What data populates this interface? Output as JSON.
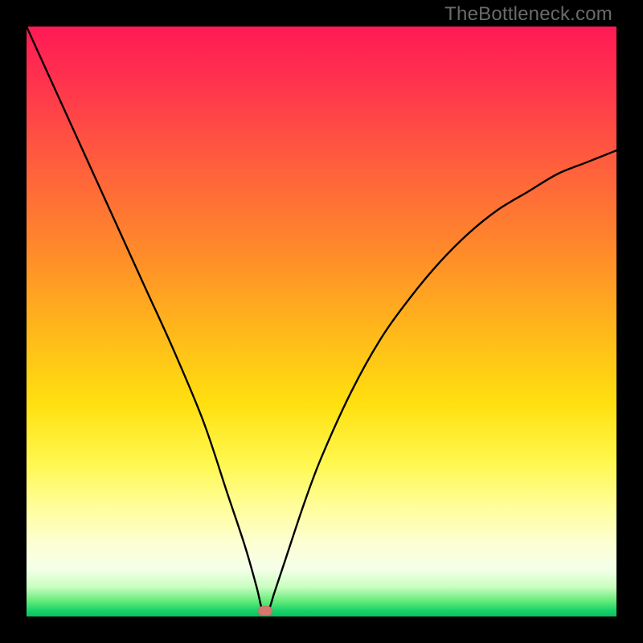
{
  "watermark": "TheBottleneck.com",
  "colors": {
    "black": "#000000",
    "curve": "#000000",
    "marker": "#d5796f"
  },
  "chart_data": {
    "type": "line",
    "title": "",
    "xlabel": "",
    "ylabel": "",
    "xlim": [
      0,
      100
    ],
    "ylim": [
      0,
      100
    ],
    "marker": {
      "x": 40.5,
      "y": 1
    },
    "series": [
      {
        "name": "bottleneck-curve",
        "x": [
          0,
          5,
          10,
          15,
          20,
          25,
          30,
          34,
          37,
          39,
          40,
          41,
          42,
          44,
          47,
          50,
          55,
          60,
          65,
          70,
          75,
          80,
          85,
          90,
          95,
          100
        ],
        "y": [
          100,
          89,
          78,
          67,
          56,
          45,
          33,
          21,
          12,
          5,
          1,
          1,
          4,
          10,
          19,
          27,
          38,
          47,
          54,
          60,
          65,
          69,
          72,
          75,
          77,
          79
        ]
      }
    ],
    "background_gradient": {
      "top": "#ff1a55",
      "mid": "#ffe010",
      "bottom": "#0abf63"
    }
  }
}
